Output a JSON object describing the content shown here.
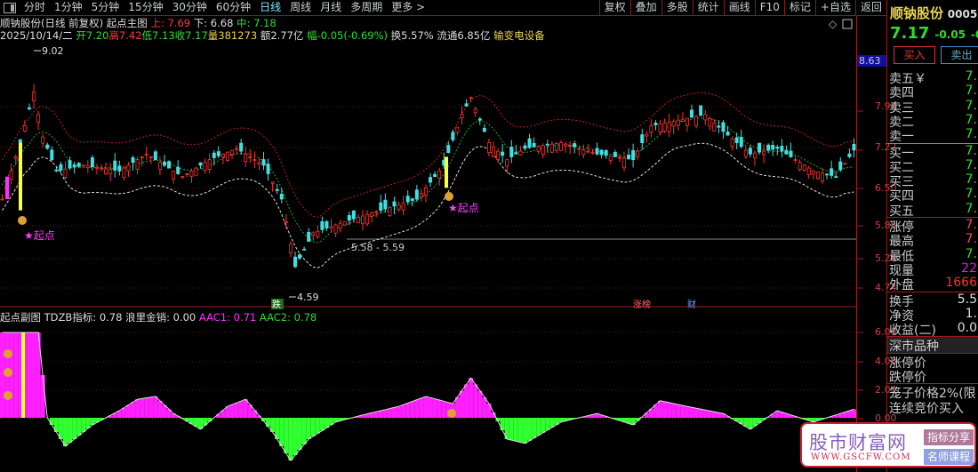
{
  "toolbar": {
    "tabs": [
      "分时",
      "1分钟",
      "5分钟",
      "15分钟",
      "30分钟",
      "60分钟",
      "日线",
      "周线",
      "月线",
      "多周期",
      "更多 >"
    ],
    "active": "日线",
    "right_buttons": [
      "复权",
      "叠加",
      "多股",
      "统计",
      "画线",
      "F10",
      "标记",
      "+自选",
      "返回"
    ]
  },
  "header": {
    "name": "顺钠股份(日线 前复权)",
    "indicator": "起点主图",
    "up_label": "上: 7.69",
    "down_label": "下: 6.68",
    "mid_label": "中: 7.18",
    "date": "2025/10/14/二",
    "open": "开7.20",
    "high": "高7.42",
    "low": "低7.13",
    "close": "收7.17",
    "vol": "量381273",
    "amount": "额2.77亿",
    "change": "幅-0.05(-0.69%)",
    "turnover": "换5.57%",
    "float": "流通6.85亿",
    "sector": "输变电设备"
  },
  "sub_header": {
    "title": "起点副图",
    "tdzb": "TDZB指标: 0.78",
    "lang": "浪里金销: 0.00",
    "aac1": "AAC1: 0.71",
    "aac2": "AAC2: 0.78"
  },
  "annotations": {
    "high": "9.02",
    "low": "4.59",
    "range": "5.58 - 5.59",
    "qidian1": "★起点",
    "qidian2": "★起点",
    "die": "跌",
    "zhangbang": "涨榜",
    "cai": "财"
  },
  "price_tag": "8.63",
  "main_axis": [
    "7.94",
    "7.22",
    "6.50",
    "5.85",
    "5.26",
    "4.74"
  ],
  "sub_axis": [
    "6.00",
    "4.00",
    "2.00",
    "0.00"
  ],
  "panel": {
    "name": "顺钠股份",
    "code": "0005",
    "price": "7.17",
    "chg": "-0.05",
    "chg_pct": "-0",
    "buy": "买入",
    "sell": "卖出",
    "asks": [
      {
        "l": "卖五￥",
        "v": "7."
      },
      {
        "l": "卖四",
        "v": "7."
      },
      {
        "l": "卖三",
        "v": "7."
      },
      {
        "l": "卖二",
        "v": "7."
      },
      {
        "l": "卖一",
        "v": "7."
      }
    ],
    "bids": [
      {
        "l": "买一",
        "v": "7."
      },
      {
        "l": "买二",
        "v": "7."
      },
      {
        "l": "买三",
        "v": "7."
      },
      {
        "l": "买四",
        "v": "7."
      },
      {
        "l": "买五",
        "v": "7."
      }
    ],
    "stats": [
      {
        "l": "涨停",
        "v": "7."
      },
      {
        "l": "最高",
        "v": "7."
      },
      {
        "l": "最低",
        "v": "7."
      },
      {
        "l": "现量",
        "v": "22"
      },
      {
        "l": "外盘",
        "v": "1666"
      }
    ],
    "stats2": [
      {
        "l": "换手",
        "v": "5.5"
      },
      {
        "l": "净资",
        "v": "1."
      },
      {
        "l": "收益(二)",
        "v": "0.0"
      }
    ],
    "market": "深市品种",
    "limit_up": "涨停价",
    "limit_down": "跌停价",
    "cage": "笼子价格2%(限",
    "cont": "连续竞价买入"
  },
  "watermark": {
    "title": "股市财富网",
    "url": "WWW.GSCFW.COM",
    "b1": "指标分享",
    "b2": "名师课程"
  },
  "chart_data": {
    "type": "candlestick",
    "ylim": [
      4.3,
      9.3
    ],
    "close_keyframes": [
      [
        0,
        6.3
      ],
      [
        4,
        7.3
      ],
      [
        7,
        8.2
      ],
      [
        9,
        7.4
      ],
      [
        12,
        6.8
      ],
      [
        18,
        6.9
      ],
      [
        26,
        6.8
      ],
      [
        32,
        7.1
      ],
      [
        40,
        6.7
      ],
      [
        46,
        7.0
      ],
      [
        52,
        7.2
      ],
      [
        58,
        6.9
      ],
      [
        62,
        6.3
      ],
      [
        65,
        5.1
      ],
      [
        69,
        5.7
      ],
      [
        76,
        5.9
      ],
      [
        84,
        6.1
      ],
      [
        92,
        6.3
      ],
      [
        98,
        6.9
      ],
      [
        102,
        7.8
      ],
      [
        104,
        8.1
      ],
      [
        108,
        7.3
      ],
      [
        112,
        7.0
      ],
      [
        116,
        7.2
      ],
      [
        124,
        7.3
      ],
      [
        132,
        7.1
      ],
      [
        140,
        7.0
      ],
      [
        144,
        7.6
      ],
      [
        150,
        7.7
      ],
      [
        156,
        7.8
      ],
      [
        160,
        7.5
      ],
      [
        166,
        7.1
      ],
      [
        172,
        7.2
      ],
      [
        180,
        6.8
      ],
      [
        185,
        6.7
      ],
      [
        189,
        7.17
      ]
    ],
    "osc_keyframes": [
      [
        0,
        6
      ],
      [
        8,
        6
      ],
      [
        10,
        0
      ],
      [
        14,
        -2
      ],
      [
        20,
        -0.5
      ],
      [
        26,
        0.5
      ],
      [
        30,
        1.3
      ],
      [
        34,
        1.5
      ],
      [
        38,
        0.3
      ],
      [
        44,
        -0.8
      ],
      [
        50,
        0.8
      ],
      [
        54,
        1.3
      ],
      [
        60,
        -1
      ],
      [
        64,
        -3
      ],
      [
        68,
        -1.5
      ],
      [
        74,
        -0.3
      ],
      [
        80,
        0.2
      ],
      [
        88,
        0.8
      ],
      [
        94,
        1.5
      ],
      [
        100,
        1
      ],
      [
        104,
        2.8
      ],
      [
        108,
        1
      ],
      [
        112,
        -1.5
      ],
      [
        116,
        -1.8
      ],
      [
        124,
        -0.3
      ],
      [
        132,
        0.3
      ],
      [
        140,
        -0.5
      ],
      [
        146,
        1.2
      ],
      [
        152,
        0.8
      ],
      [
        160,
        0.3
      ],
      [
        166,
        -0.8
      ],
      [
        172,
        0.5
      ],
      [
        180,
        -0.3
      ],
      [
        189,
        0.6
      ]
    ]
  }
}
